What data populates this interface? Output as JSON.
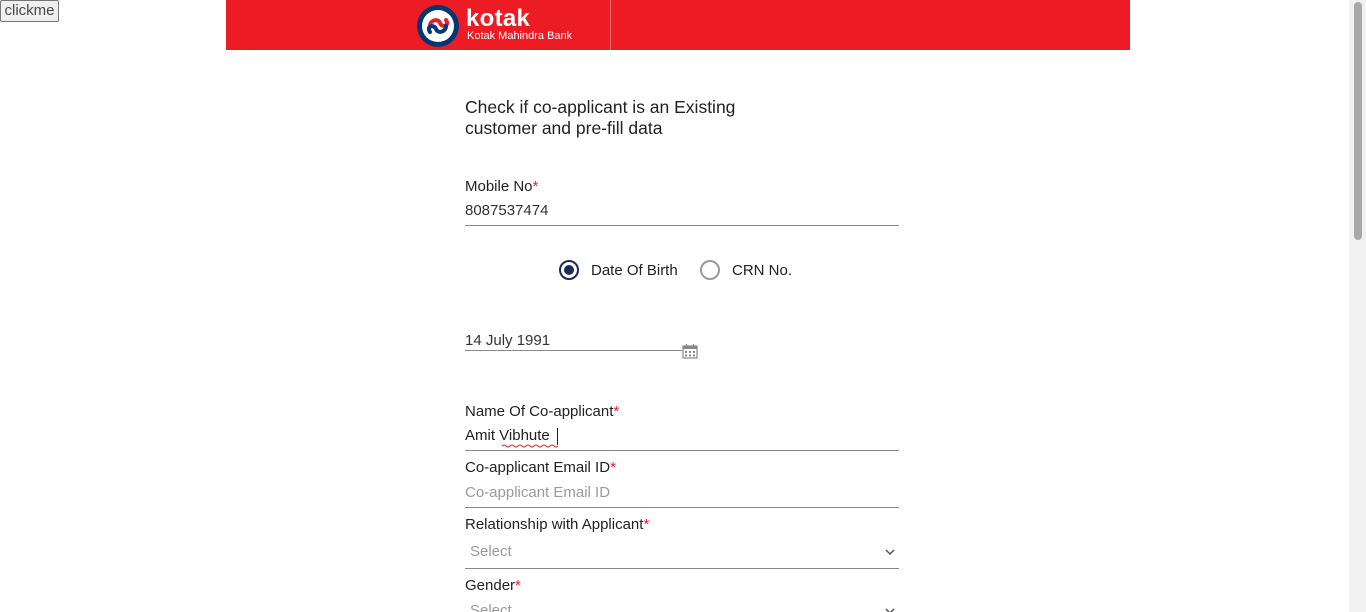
{
  "top_button": {
    "label": "clickme"
  },
  "brand": {
    "name": "kotak",
    "subtitle": "Kotak Mahindra Bank",
    "color": "#ed1c24"
  },
  "form": {
    "heading": "Check if co-applicant is an Existing customer and pre-fill data",
    "mobile": {
      "label": "Mobile No",
      "required_mark": "*",
      "value": "8087537474"
    },
    "id_type": {
      "options": [
        {
          "label": "Date Of Birth",
          "checked": true
        },
        {
          "label": "CRN No.",
          "checked": false
        }
      ]
    },
    "dob": {
      "value": "14 July 1991",
      "icon": "calendar-icon"
    },
    "name": {
      "label": "Name Of Co-applicant",
      "required_mark": "*",
      "value": "Amit Vibhute"
    },
    "email": {
      "label": "Co-applicant Email ID",
      "required_mark": "*",
      "placeholder": "Co-applicant Email ID"
    },
    "relationship": {
      "label": "Relationship with Applicant",
      "required_mark": "*",
      "selected": "Select",
      "icon": "chevron-down-icon"
    },
    "gender": {
      "label": "Gender",
      "required_mark": "*",
      "selected": "Select",
      "icon": "chevron-down-icon"
    }
  }
}
